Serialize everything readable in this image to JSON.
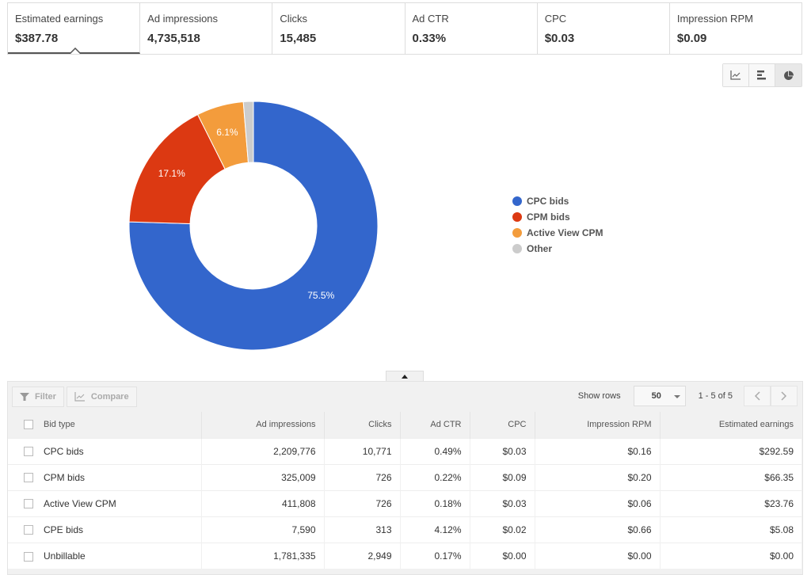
{
  "scorecards": [
    {
      "label": "Estimated earnings",
      "value": "$387.78",
      "selected": true
    },
    {
      "label": "Ad impressions",
      "value": "4,735,518"
    },
    {
      "label": "Clicks",
      "value": "15,485"
    },
    {
      "label": "Ad CTR",
      "value": "0.33%"
    },
    {
      "label": "CPC",
      "value": "$0.03"
    },
    {
      "label": "Impression RPM",
      "value": "$0.09"
    }
  ],
  "chart_types": [
    {
      "icon": "line-chart-icon"
    },
    {
      "icon": "bar-chart-icon"
    },
    {
      "icon": "pie-chart-icon",
      "active": true
    }
  ],
  "chart_data": {
    "type": "pie",
    "donut": true,
    "title": "",
    "categories": [
      "CPC bids",
      "CPM bids",
      "Active View CPM",
      "Other"
    ],
    "values": [
      75.5,
      17.1,
      6.1,
      1.3
    ],
    "labels": [
      "75.5%",
      "17.1%",
      "6.1%",
      ""
    ],
    "colors": [
      "#3366cc",
      "#dc3912",
      "#f39c3c",
      "#cccccc"
    ],
    "legend_position": "right"
  },
  "toolbar": {
    "filter_label": "Filter",
    "compare_label": "Compare",
    "show_rows_label": "Show rows",
    "rows_value": "50",
    "range_text": "1 - 5 of 5"
  },
  "table": {
    "headers": [
      "Bid type",
      "Ad impressions",
      "Clicks",
      "Ad CTR",
      "CPC",
      "Impression RPM",
      "Estimated earnings"
    ],
    "rows": [
      [
        "CPC bids",
        "2,209,776",
        "10,771",
        "0.49%",
        "$0.03",
        "$0.16",
        "$292.59"
      ],
      [
        "CPM bids",
        "325,009",
        "726",
        "0.22%",
        "$0.09",
        "$0.20",
        "$66.35"
      ],
      [
        "Active View CPM",
        "411,808",
        "726",
        "0.18%",
        "$0.03",
        "$0.06",
        "$23.76"
      ],
      [
        "CPE bids",
        "7,590",
        "313",
        "4.12%",
        "$0.02",
        "$0.66",
        "$5.08"
      ],
      [
        "Unbillable",
        "1,781,335",
        "2,949",
        "0.17%",
        "$0.00",
        "$0.00",
        "$0.00"
      ]
    ]
  }
}
